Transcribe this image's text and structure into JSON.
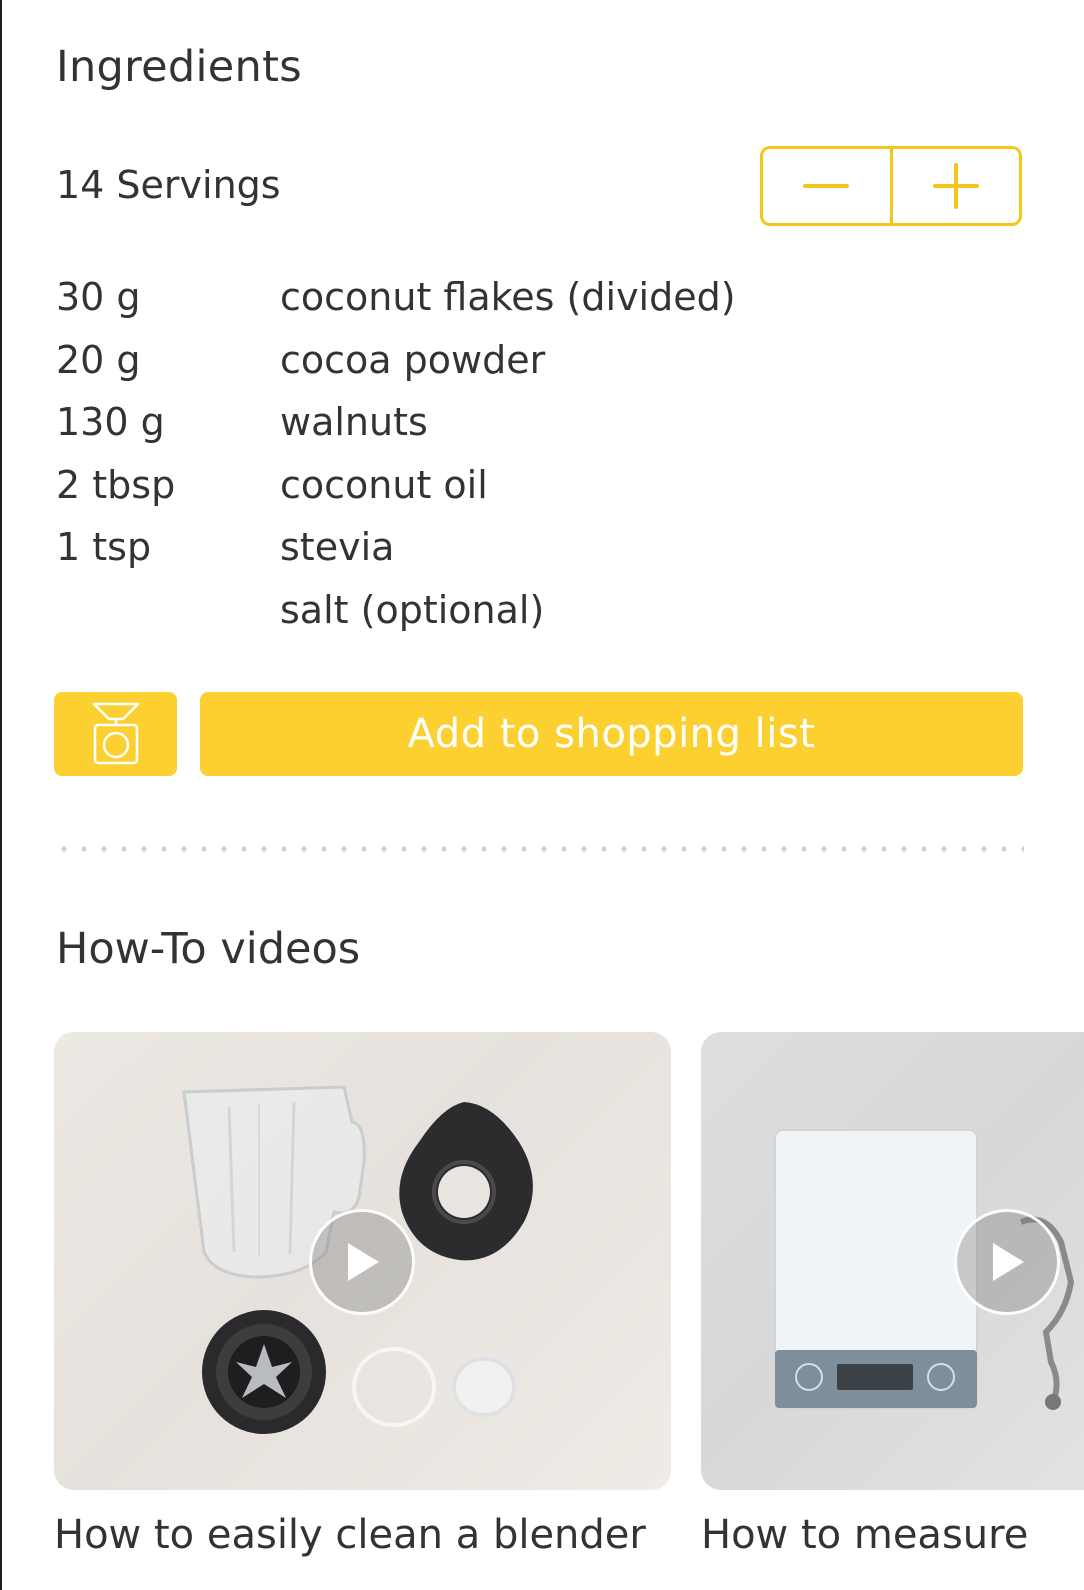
{
  "ingredients_section": {
    "title": "Ingredients",
    "servings_label": "14 Servings",
    "items": [
      {
        "qty": "30 g",
        "name": "coconut flakes (divided)"
      },
      {
        "qty": "20 g",
        "name": "cocoa powder"
      },
      {
        "qty": "130 g",
        "name": "walnuts"
      },
      {
        "qty": "2 tbsp",
        "name": "coconut oil"
      },
      {
        "qty": "1 tsp",
        "name": "stevia"
      },
      {
        "qty": "",
        "name": "salt (optional)"
      }
    ],
    "add_to_list_label": "Add to shopping list"
  },
  "videos_section": {
    "title": "How-To videos",
    "videos": [
      {
        "title": "How to easily clean a blender"
      },
      {
        "title": "How to measure"
      }
    ]
  },
  "colors": {
    "accent": "#fdd031",
    "accent_border": "#f4c619",
    "text": "#333333",
    "button_text": "#ffffff"
  },
  "icons": {
    "decrease": "minus-icon",
    "increase": "plus-icon",
    "scale": "kitchen-scale-icon",
    "play": "play-icon"
  }
}
